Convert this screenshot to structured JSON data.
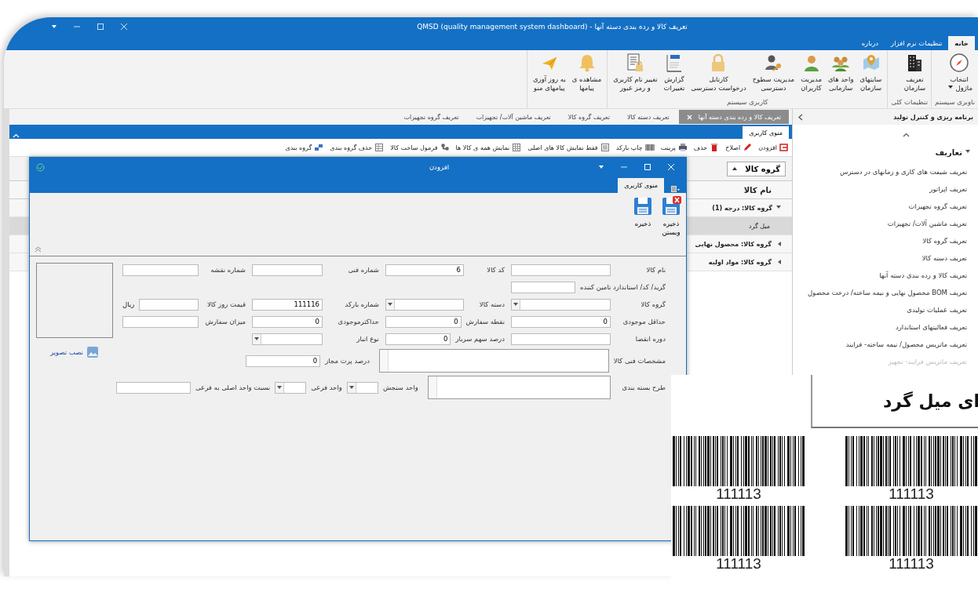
{
  "window": {
    "title": "تعریف  کالا و رده بندی دسته آنها - QMSD (quality management system dashboard)"
  },
  "ribbon_tabs": [
    {
      "label": "خانه",
      "selected": true
    },
    {
      "label": "تنظیمات نرم افزار",
      "selected": false
    },
    {
      "label": "درباره",
      "selected": false
    }
  ],
  "ribbon_groups": [
    {
      "label": "ناوبری سیستم",
      "buttons": [
        {
          "label": "انتخاب\nماژول",
          "dropdown": true
        }
      ]
    },
    {
      "label": "تنظیمات کلی",
      "buttons": [
        {
          "label": "تعریف\nسازمان",
          "dropdown": false
        }
      ]
    },
    {
      "label": "کاربری سیستم",
      "buttons": [
        {
          "label": "سایتهای\nسازمان",
          "dropdown": false
        },
        {
          "label": "واحد های\nسازمانی",
          "dropdown": false
        },
        {
          "label": "مدیریت\nکاربران",
          "dropdown": false
        },
        {
          "label": "مدیریت سطوح\nدسترسی",
          "dropdown": false
        },
        {
          "label": "کارتابل\nدرخواست دسترسی",
          "dropdown": false
        },
        {
          "label": "گزارش\nتغییرات",
          "dropdown": false
        },
        {
          "label": "تغییر نام کاربری\nو رمز عبور",
          "dropdown": false
        }
      ]
    },
    {
      "buttons": [
        {
          "label": "مشاهده ی\nپیامها",
          "dropdown": false
        },
        {
          "label": "به روز آوری\nپیامهای منو",
          "dropdown": false
        }
      ]
    }
  ],
  "sidebar": {
    "title": "برنامه ریزی و کنترل تولید",
    "section": {
      "label": "تعاریف",
      "expanded": true
    },
    "items": [
      "تعریف شیفت های کاری و زمانهای در دسترس",
      "تعریف اپراتور",
      "تعریف گروه تجهیزات",
      "تعریف ماشین آلات/ تجهیزات",
      "تعریف گروه کالا",
      "تعریف دسته کالا",
      "تعریف  کالا و رده بندی دسته آنها",
      "تعریف BOM محصول نهایی و نیمه ساخته/ درخت محصول",
      "تعریف عملیات تولیدی",
      "تعریف فعالیتهای استاندارد",
      "تعریف ماتریس محصول/ نیمه ساخته- فرایند",
      "تعریف ماتریس فرایند- تجهیز"
    ]
  },
  "doc_tabs": [
    {
      "label": "تعریف  کالا و رده بندی دسته آنها",
      "selected": true
    },
    {
      "label": "تعریف دسته کالا",
      "selected": false
    },
    {
      "label": "تعریف گروه کالا",
      "selected": false
    },
    {
      "label": "تعریف ماشین آلات/ تجهیزات",
      "selected": false
    },
    {
      "label": "تعریف گروه تجهیزات",
      "selected": false
    }
  ],
  "menu_tab": "منوی کاربری",
  "toolbar": [
    "افزودن",
    "اصلاح",
    "حذف",
    "پرینت",
    "چاپ بارکد",
    "فقط نمایش کالا های اصلی",
    "نمایش همه ی کالا ها",
    "فرمول ساخت کالا",
    "حذف گروه بندی",
    "گروه بندی"
  ],
  "grid": {
    "group_by": "گروه کالا",
    "column": "نام کالا",
    "rows": [
      {
        "label": "گروه کالا: درجه (1)",
        "kind": "group",
        "expanded": true,
        "selected": false
      },
      {
        "label": "میل گرد",
        "kind": "item",
        "selected": true
      },
      {
        "label": "گروه کالا: محصول نهایی",
        "kind": "group",
        "expanded": false,
        "selected": false
      },
      {
        "label": "گروه کالا: مواد اولیه",
        "kind": "group",
        "expanded": false,
        "selected": false
      }
    ]
  },
  "dialog": {
    "title": "افزودن",
    "tab": "منوی کاربری",
    "buttons": [
      "ذخیره\nوبستن",
      "ذخیره"
    ],
    "form_rows": [
      [
        {
          "label": "نام کالا",
          "kind": "text"
        },
        {
          "label": "کد کالا",
          "kind": "text",
          "value": "6"
        },
        {
          "label": "شماره فنی",
          "kind": "text"
        },
        {
          "label": "شماره نقشه",
          "kind": "text"
        }
      ],
      [
        {
          "label": "گرید/ کد/ استاندارد تامین کننده",
          "kind": "text"
        }
      ],
      [
        {
          "label": "گروه کالا",
          "kind": "dropdown"
        },
        {
          "label": "دسته کالا",
          "kind": "dropdown"
        },
        {
          "label": "شماره بارکد",
          "kind": "text",
          "value": "111116"
        },
        {
          "label": "قیمت روز کالا",
          "kind": "text",
          "suffix": "ریال"
        }
      ],
      [
        {
          "label": "حداقل موجودی",
          "kind": "text",
          "value": "0"
        },
        {
          "label": "نقطه سفارش",
          "kind": "text",
          "value": "0"
        },
        {
          "label": "حداکثرموجودی",
          "kind": "text",
          "value": "0"
        },
        {
          "label": "میزان سفارش",
          "kind": "text"
        }
      ],
      [
        {
          "label": "دوره انقضا",
          "kind": "text"
        },
        {
          "label": "درصد سهم سربار",
          "kind": "text",
          "value": "0"
        },
        {
          "label": "نوع انبار",
          "kind": "dropdown"
        }
      ],
      [
        {
          "label": "مشخصات فنی کالا",
          "kind": "textarea"
        },
        {
          "label": "درصد پرت مجاز",
          "kind": "text",
          "value": "0"
        }
      ],
      [
        {
          "label": "طرح بسته بندی",
          "kind": "textarea"
        },
        {
          "label": "واحد سنجش",
          "kind": "dropdown"
        },
        {
          "label": "واحد فرعی",
          "kind": "dropdown"
        },
        {
          "label": "نسبت واحد اصلی به فرعی",
          "kind": "text"
        }
      ]
    ],
    "image_link": "نصب تصویر"
  },
  "barcode_sheet": {
    "heading": "ای میل گرد",
    "labels": [
      "111113",
      "111113",
      "111113",
      "111113"
    ]
  }
}
